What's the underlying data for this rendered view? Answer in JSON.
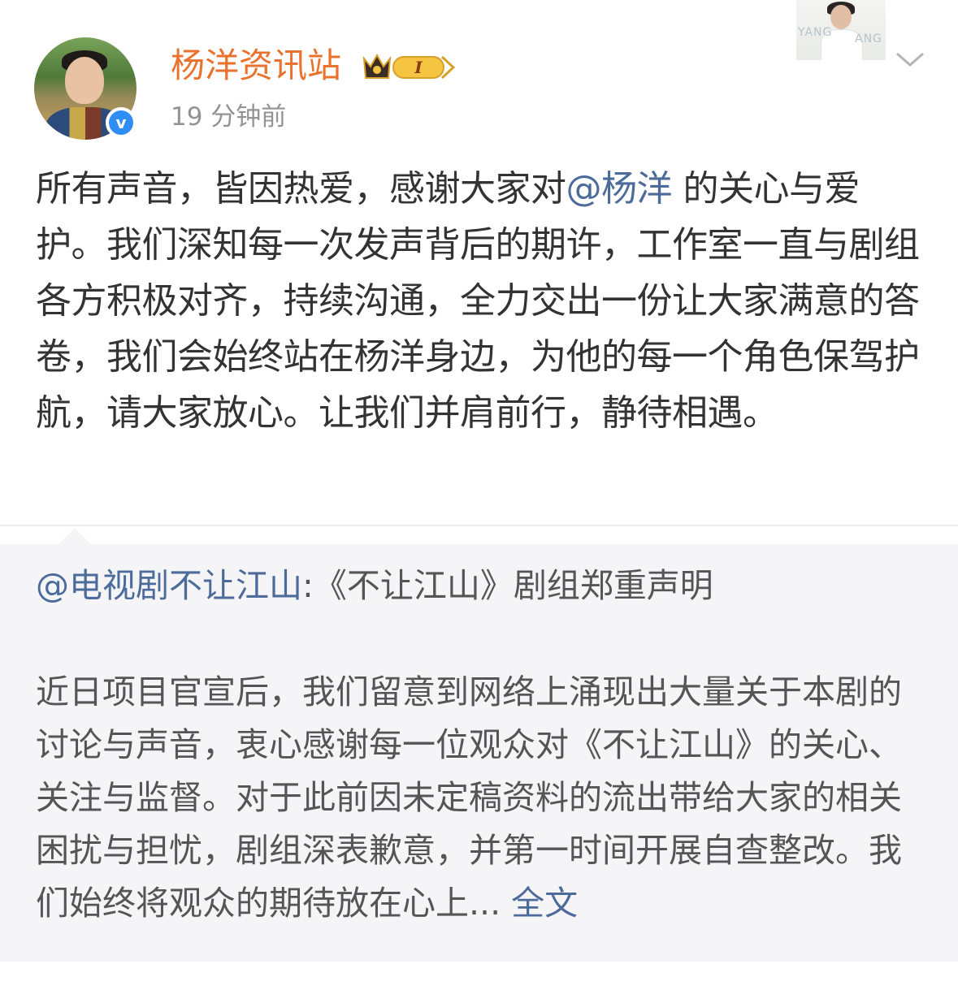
{
  "post": {
    "author": "杨洋资讯站",
    "verified_label": "v",
    "level_badge": "I",
    "time": "19 分钟前",
    "text_before_mention": "所有声音，皆因热爱，感谢大家对",
    "mention": "@杨洋",
    "text_after_mention": " 的关心与爱护。我们深知每一次发声背后的期许，工作室一直与剧组各方积极对齐，持续沟通，全力交出一份让大家满意的答卷，我们会始终站在杨洋身边，为他的每一个角色保驾护航，请大家放心。让我们并肩前行，静待相遇。"
  },
  "header_thumb": {
    "text_left": "YANG",
    "text_right": "ANG"
  },
  "repost": {
    "source": "@电视剧不让江山",
    "title": ":《不让江山》剧组郑重声明",
    "body": "近日项目官宣后，我们留意到网络上涌现出大量关于本剧的讨论与声音，衷心感谢每一位观众对《不让江山》的关心、关注与监督。对于此前因未定稿资料的流出带给大家的相关困扰与担忧，剧组深表歉意，并第一时间开展自查整改。我们始终将观众的期待放在心上... ",
    "full_text_link": "全文"
  },
  "colors": {
    "username": "#e8722e",
    "link": "#4c6b9a",
    "verified": "#2f8ef4",
    "repost_bg": "#f5f5f7"
  },
  "icons": [
    "verified-badge-icon",
    "crown-level-icon",
    "chevron-down-icon"
  ]
}
